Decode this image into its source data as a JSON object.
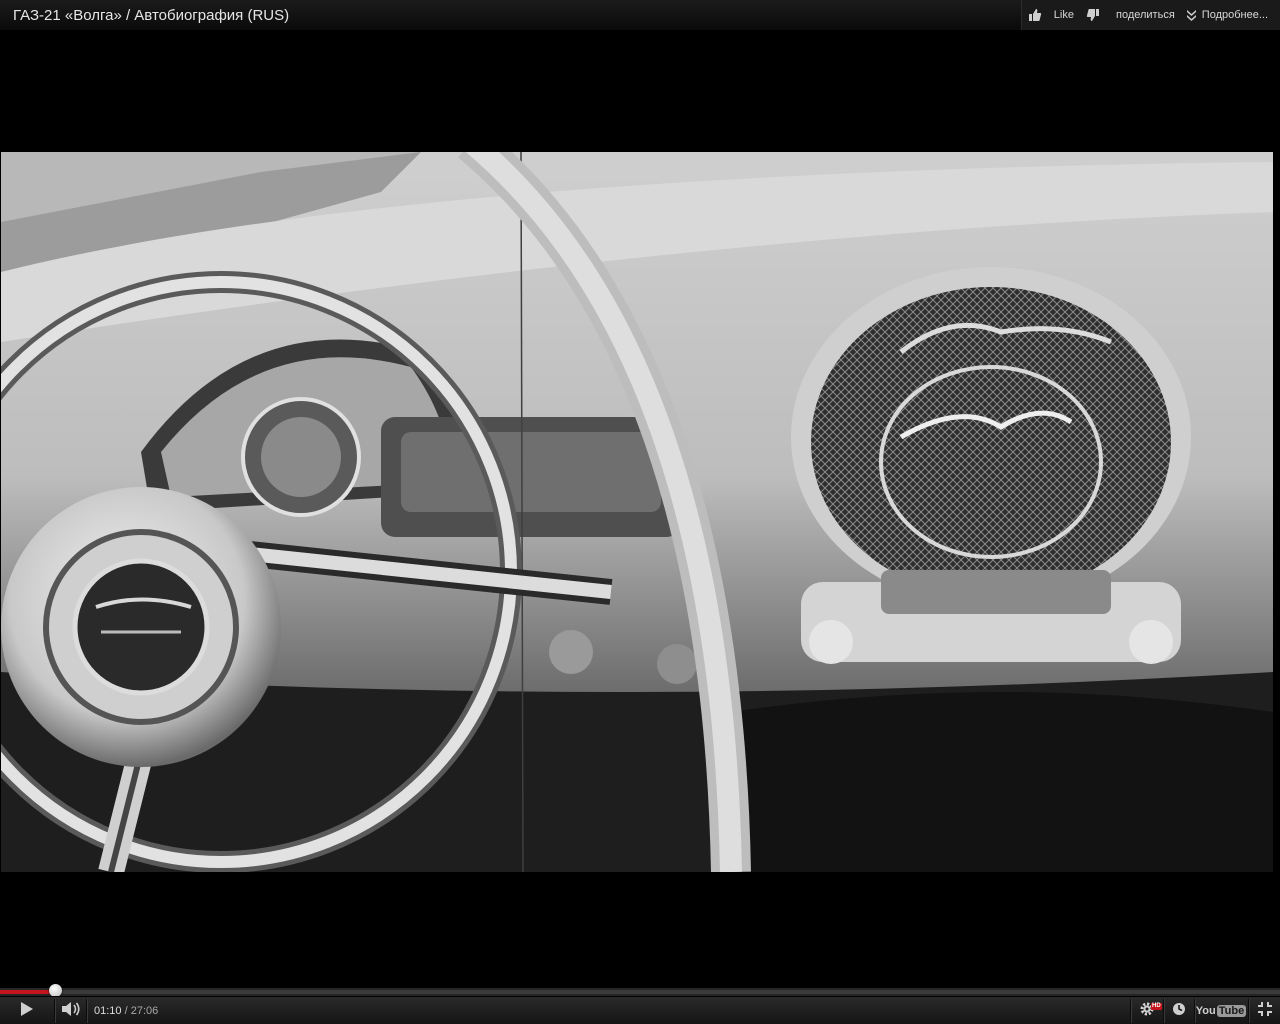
{
  "video": {
    "title": "ГАЗ-21 «Волга» / Автобиография (RUS)"
  },
  "top_actions": {
    "like_label": "Like",
    "share_label": "поделиться",
    "more_label": "Подробнее..."
  },
  "playback": {
    "current_time": "01:10",
    "separator": " / ",
    "duration": "27:06",
    "progress_fraction": 0.0431
  },
  "controls": {
    "hd_badge": "HD",
    "logo_you": "You",
    "logo_tube": "Tube"
  },
  "colors": {
    "progress_played": "#c4151c",
    "hd_badge": "#c4151c"
  },
  "icons": {
    "like": "thumbs-up-icon",
    "dislike": "thumbs-down-icon",
    "more": "double-chevron-down-icon",
    "play": "play-icon",
    "volume": "volume-icon",
    "settings": "gear-icon",
    "watch_later": "clock-icon",
    "fullscreen": "fullscreen-icon"
  }
}
